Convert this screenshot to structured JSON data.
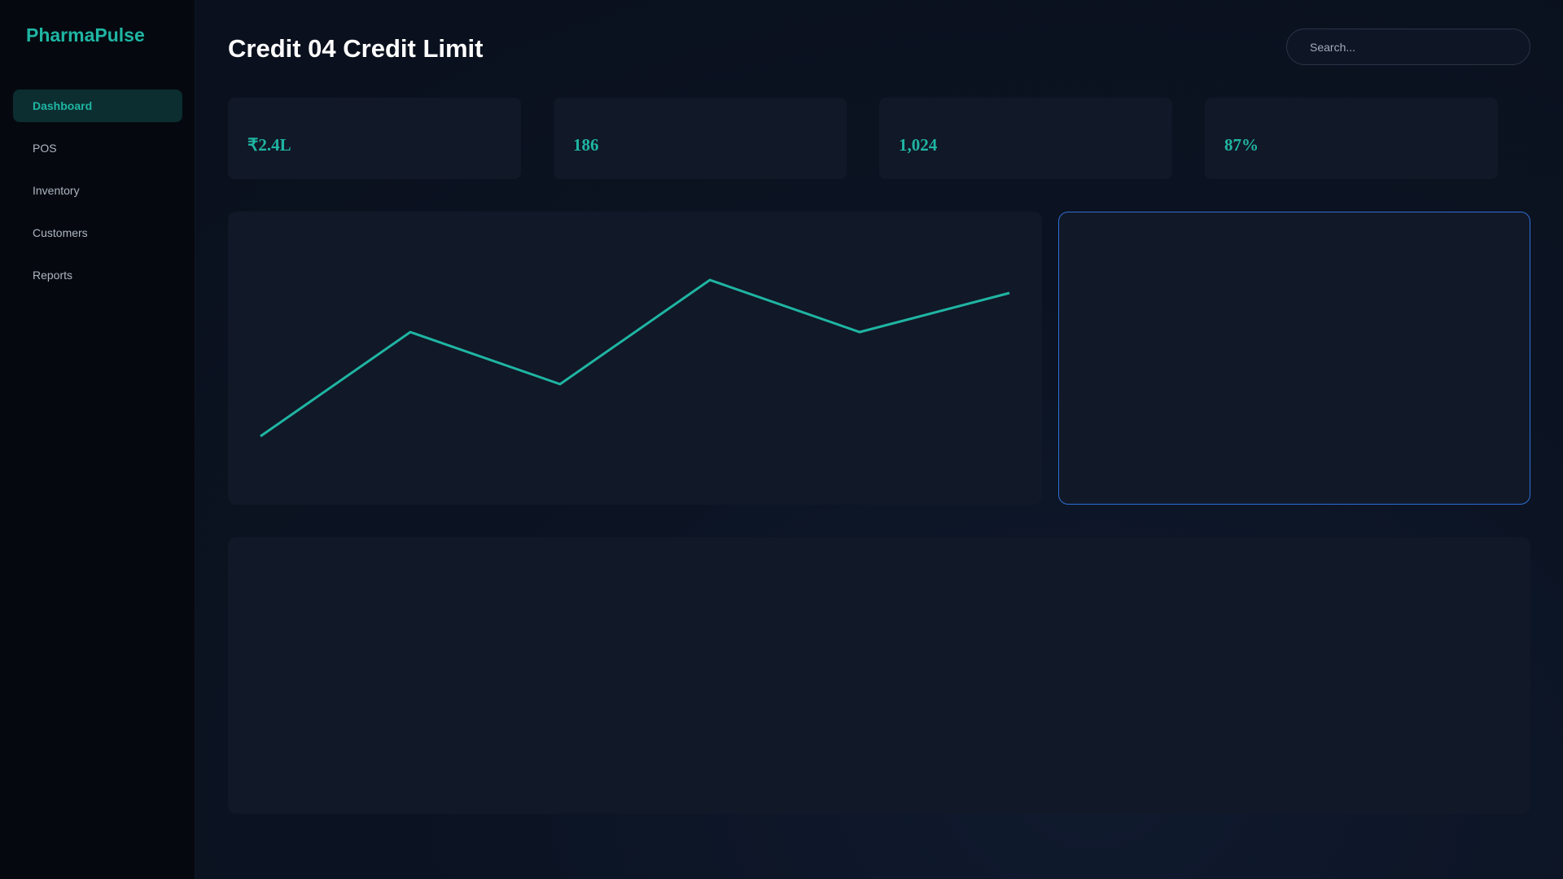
{
  "app": {
    "name": "PharmaPulse"
  },
  "sidebar": {
    "items": [
      {
        "label": "Dashboard",
        "active": true
      },
      {
        "label": "POS",
        "active": false
      },
      {
        "label": "Inventory",
        "active": false
      },
      {
        "label": "Customers",
        "active": false
      },
      {
        "label": "Reports",
        "active": false
      }
    ]
  },
  "header": {
    "title": "Credit 04 Credit Limit",
    "search_placeholder": "Search..."
  },
  "stats": [
    {
      "value": "₹2.4L"
    },
    {
      "value": "186"
    },
    {
      "value": "1,024"
    },
    {
      "value": "87%"
    }
  ],
  "colors": {
    "accent": "#1fb5a3",
    "highlight_border": "#2f6fd6",
    "card_bg": "#111827",
    "sidebar_bg": "#05090f"
  },
  "trend_line": {
    "values": [
      20,
      60,
      40,
      80,
      60,
      75
    ],
    "ymin": 0,
    "ymax": 100
  }
}
